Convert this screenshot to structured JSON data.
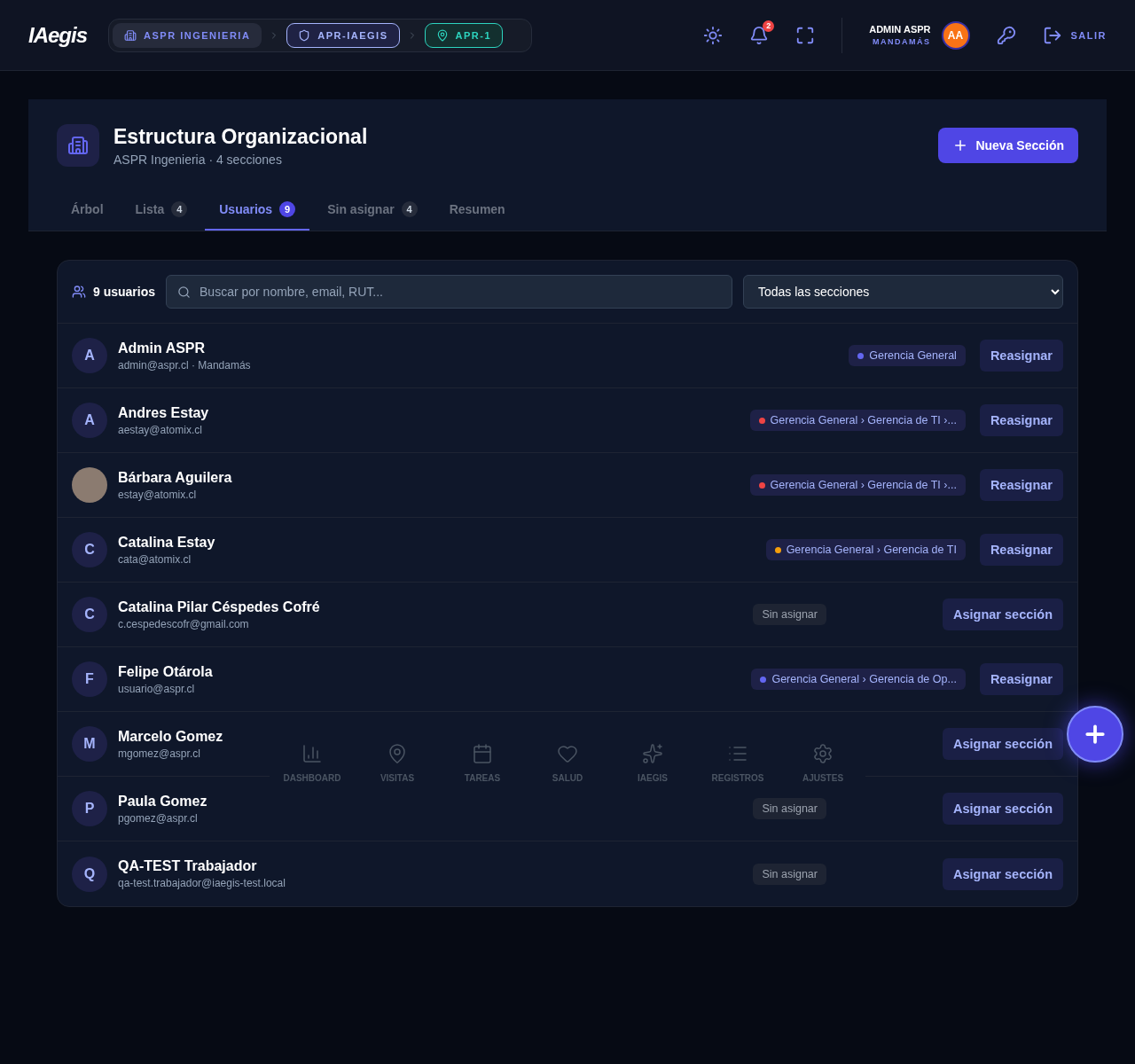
{
  "header": {
    "logo": "IAegis",
    "breadcrumb": [
      {
        "label": "ASPR INGENIERIA",
        "kind": "company",
        "selected": false
      },
      {
        "label": "APR-IAEGIS",
        "kind": "shield",
        "selected": true
      },
      {
        "label": "APR-1",
        "kind": "pin",
        "selected": true
      }
    ],
    "notifications": "2",
    "user": {
      "name": "ADMIN ASPR",
      "role": "MANDAMÁS",
      "initials": "AA"
    },
    "logout": "SALIR"
  },
  "page": {
    "title": "Estructura Organizacional",
    "subtitle": "ASPR Ingenieria · 4 secciones",
    "action": "Nueva Sección",
    "tabs": [
      {
        "label": "Árbol",
        "selected": false
      },
      {
        "label": "Lista",
        "count": "4",
        "selected": false
      },
      {
        "label": "Usuarios",
        "count": "9",
        "selected": true
      },
      {
        "label": "Sin asignar",
        "count": "4",
        "selected": false
      },
      {
        "label": "Resumen",
        "selected": false
      }
    ]
  },
  "users": {
    "count": "9 usuarios",
    "search": {
      "placeholder": "Buscar por nombre, email, RUT..."
    },
    "filter": "Todas las secciones",
    "rows": [
      {
        "avatar": {
          "kind": "letter",
          "text": "A"
        },
        "name": "Admin ASPR",
        "detail": "admin@aspr.cl · Mandamás",
        "section": {
          "kind": "assigned",
          "label": "Gerencia General",
          "color": "#6366f1"
        },
        "action": "Reasignar"
      },
      {
        "avatar": {
          "kind": "letter",
          "text": "A"
        },
        "name": "Andres Estay",
        "detail": "aestay@atomix.cl",
        "section": {
          "kind": "assigned",
          "label": "Gerencia General › Gerencia de TI ›...",
          "color": "#ef4444"
        },
        "action": "Reasignar"
      },
      {
        "avatar": {
          "kind": "photo"
        },
        "name": "Bárbara Aguilera",
        "detail": "estay@atomix.cl",
        "section": {
          "kind": "assigned",
          "label": "Gerencia General › Gerencia de TI ›...",
          "color": "#ef4444"
        },
        "action": "Reasignar"
      },
      {
        "avatar": {
          "kind": "letter",
          "text": "C"
        },
        "name": "Catalina Estay",
        "detail": "cata@atomix.cl",
        "section": {
          "kind": "assigned",
          "label": "Gerencia General › Gerencia de TI",
          "color": "#f59e0b"
        },
        "action": "Reasignar"
      },
      {
        "avatar": {
          "kind": "letter",
          "text": "C"
        },
        "name": "Catalina Pilar Céspedes Cofré",
        "detail": "c.cespedescofr@gmail.com",
        "section": {
          "kind": "unassigned",
          "label": "Sin asignar"
        },
        "action": "Asignar sección"
      },
      {
        "avatar": {
          "kind": "letter",
          "text": "F"
        },
        "name": "Felipe Otárola",
        "detail": "usuario@aspr.cl",
        "section": {
          "kind": "assigned",
          "label": "Gerencia General › Gerencia de Op...",
          "color": "#6366f1"
        },
        "action": "Reasignar"
      },
      {
        "avatar": {
          "kind": "letter",
          "text": "M"
        },
        "name": "Marcelo Gomez",
        "detail": "mgomez@aspr.cl",
        "action": "Asignar sección"
      },
      {
        "avatar": {
          "kind": "letter",
          "text": "P"
        },
        "name": "Paula Gomez",
        "detail": "pgomez@aspr.cl",
        "section": {
          "kind": "unassigned",
          "label": "Sin asignar"
        },
        "action": "Asignar sección"
      },
      {
        "avatar": {
          "kind": "letter",
          "text": "Q"
        },
        "name": "QA-TEST Trabajador",
        "detail": "qa-test.trabajador@iaegis-test.local",
        "section": {
          "kind": "unassigned",
          "label": "Sin asignar"
        },
        "action": "Asignar sección"
      }
    ]
  },
  "bottom_nav": [
    {
      "label": "DASHBOARD",
      "kind": "chart"
    },
    {
      "label": "VISITAS",
      "kind": "pin"
    },
    {
      "label": "TAREAS",
      "kind": "calendar"
    },
    {
      "label": "SALUD",
      "kind": "heart"
    },
    {
      "label": "IAEGIS",
      "kind": "sparkle"
    },
    {
      "label": "REGISTROS",
      "kind": "list"
    },
    {
      "label": "AJUSTES",
      "kind": "gear"
    }
  ]
}
